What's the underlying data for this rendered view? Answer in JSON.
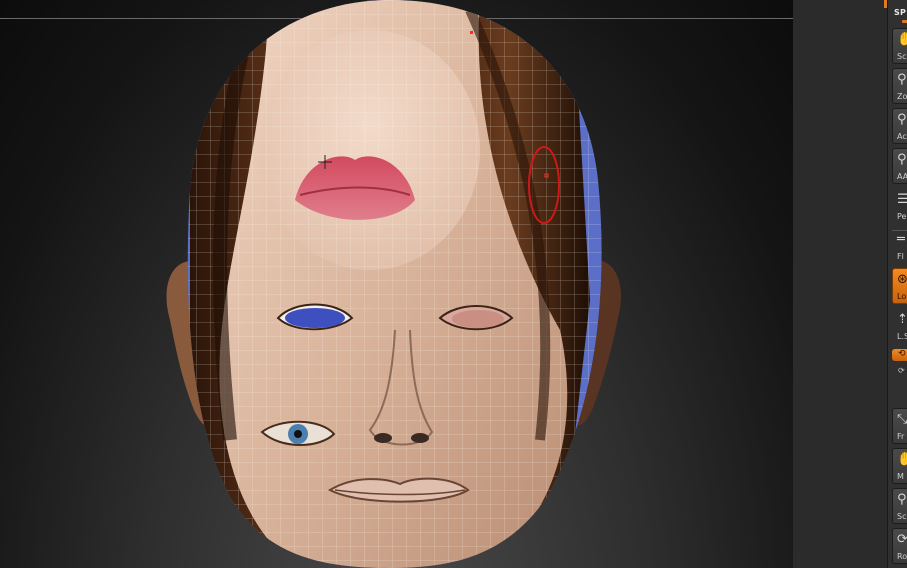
{
  "viewport": {
    "label": "3D head model with projected face texture"
  },
  "shelf": {
    "title": "SP",
    "tools": [
      {
        "label": "Sc",
        "icon": "hand"
      },
      {
        "label": "Zo",
        "icon": "magnifier"
      },
      {
        "label": "Ac",
        "icon": "magnifier"
      },
      {
        "label": "AA",
        "icon": "magnifier"
      },
      {
        "label": "Pe",
        "icon": "lines"
      },
      {
        "label": "Fl",
        "icon": "lines"
      },
      {
        "label": "Lo",
        "icon": "lock"
      },
      {
        "label": "L.S",
        "icon": "arrows"
      },
      {
        "label": "Fr",
        "icon": "frame"
      },
      {
        "label": "M",
        "icon": "hand"
      },
      {
        "label": "Sc",
        "icon": "magnifier"
      },
      {
        "label": "Ro",
        "icon": "rotate"
      }
    ]
  }
}
